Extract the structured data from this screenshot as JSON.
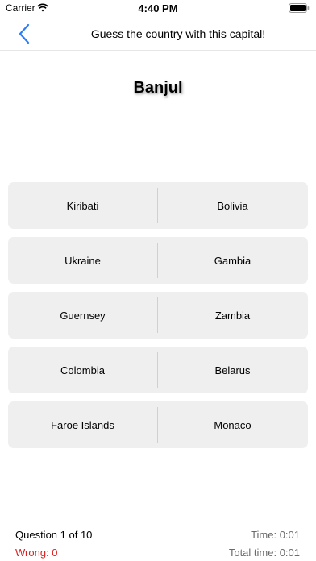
{
  "status_bar": {
    "carrier": "Carrier",
    "time": "4:40 PM"
  },
  "nav": {
    "title": "Guess the country with this capital!",
    "back_icon": "chevron-left-icon",
    "accent_color": "#2f7cf6"
  },
  "question": {
    "capital": "Banjul"
  },
  "answers": [
    [
      "Kiribati",
      "Bolivia"
    ],
    [
      "Ukraine",
      "Gambia"
    ],
    [
      "Guernsey",
      "Zambia"
    ],
    [
      "Colombia",
      "Belarus"
    ],
    [
      "Faroe Islands",
      "Monaco"
    ]
  ],
  "footer": {
    "question_label": "Question  1 of 10",
    "wrong_label": "Wrong: 0",
    "time_label": "Time: 0:01",
    "total_time_label": "Total time: 0:01",
    "wrong_color": "#e02020"
  }
}
